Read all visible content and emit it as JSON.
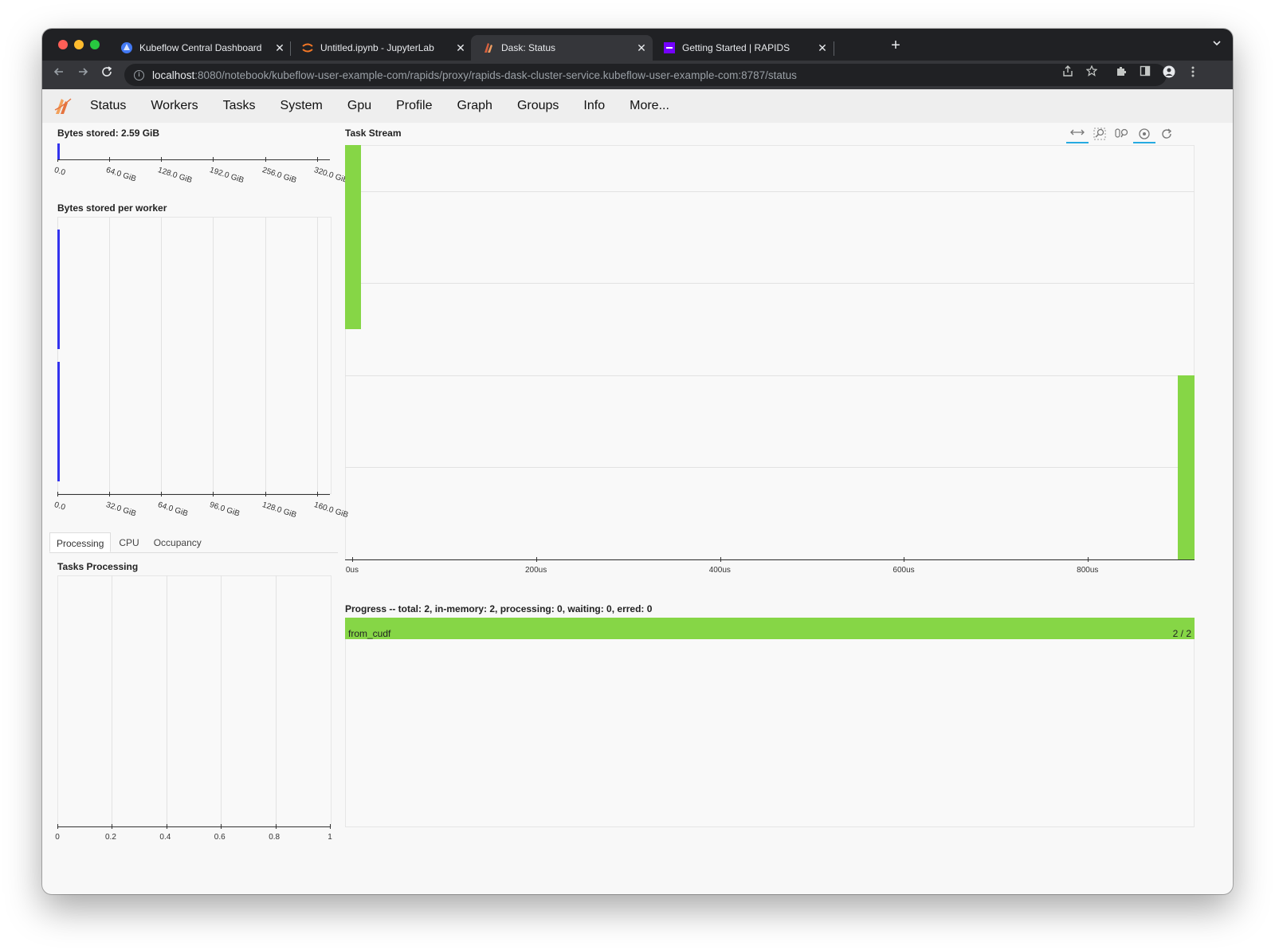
{
  "browser": {
    "tabs": [
      {
        "title": "Kubeflow Central Dashboard",
        "icon": "kubeflow-icon",
        "active": false
      },
      {
        "title": "Untitled.ipynb - JupyterLab",
        "icon": "jupyter-icon",
        "active": false
      },
      {
        "title": "Dask: Status",
        "icon": "dask-icon",
        "active": true
      },
      {
        "title": "Getting Started | RAPIDS",
        "icon": "rapids-icon",
        "active": false
      }
    ],
    "close_glyph": "✕",
    "new_tab_glyph": "+",
    "url_host": "localhost",
    "url_path": ":8080/notebook/kubeflow-user-example-com/rapids/proxy/rapids-dask-cluster-service.kubeflow-user-example-com:8787/status"
  },
  "dask_nav": [
    "Status",
    "Workers",
    "Tasks",
    "System",
    "Gpu",
    "Profile",
    "Graph",
    "Groups",
    "Info",
    "More..."
  ],
  "panels": {
    "bytes_stored_title": "Bytes stored: 2.59 GiB",
    "bytes_per_worker_title": "Bytes stored per worker",
    "subtabs": [
      "Processing",
      "CPU",
      "Occupancy"
    ],
    "tasks_processing_title": "Tasks Processing",
    "task_stream_title": "Task Stream",
    "progress_title": "Progress -- total: 2, in-memory: 2, processing: 0, waiting: 0, erred: 0",
    "progress_task_name": "from_cudf",
    "progress_task_count": "2 / 2"
  },
  "colors": {
    "memory_bar": "#3333ee",
    "task_green": "#86d646"
  },
  "chart_data": [
    {
      "type": "bar",
      "name": "bytes-stored",
      "orientation": "horizontal",
      "title": "Bytes stored: 2.59 GiB",
      "xticks": [
        "0.0",
        "64.0 GiB",
        "128.0 GiB",
        "192.0 GiB",
        "256.0 GiB",
        "320.0 GiB"
      ],
      "xlim_gib": [
        0,
        336
      ],
      "values_gib": [
        2.59
      ]
    },
    {
      "type": "bar",
      "name": "bytes-per-worker",
      "orientation": "horizontal",
      "title": "Bytes stored per worker",
      "xticks": [
        "0.0",
        "32.0 GiB",
        "64.0 GiB",
        "96.0 GiB",
        "128.0 GiB",
        "160.0 GiB"
      ],
      "xlim_gib": [
        0,
        168
      ],
      "values_gib": [
        1.3,
        1.3
      ]
    },
    {
      "type": "bar",
      "name": "tasks-processing",
      "title": "Tasks Processing",
      "xticks": [
        "0",
        "0.2",
        "0.4",
        "0.6",
        "0.8",
        "1"
      ],
      "xlim": [
        0,
        1
      ],
      "values": []
    },
    {
      "type": "bar",
      "name": "task-stream",
      "title": "Task Stream",
      "xticks": [
        "0us",
        "200us",
        "400us",
        "600us",
        "800us"
      ],
      "xlim_us": [
        -8,
        916
      ],
      "rows": 4.5,
      "tasks": [
        {
          "start_us": -8,
          "end_us": 9,
          "row_start": 0,
          "row_end": 2
        },
        {
          "start_us": 898,
          "end_us": 916,
          "row_start": 2.5,
          "row_end": 4.5
        }
      ]
    }
  ]
}
